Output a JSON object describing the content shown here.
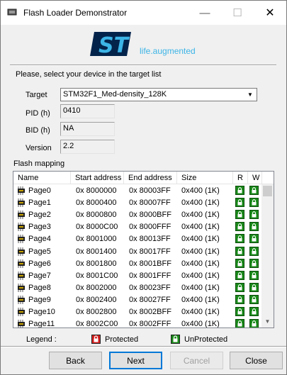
{
  "window": {
    "title": "Flash Loader Demonstrator",
    "min_icon": "minimize-icon",
    "max_icon": "maximize-icon",
    "close_icon": "close-icon"
  },
  "logo": {
    "brand": "ST",
    "tagline": "life.augmented",
    "brand_color": "#3cb4e6",
    "tagline_color": "#3cb4e6",
    "mark_color": "#03234b"
  },
  "prompt": "Please, select your device in the target list",
  "fields": {
    "target_label": "Target",
    "target_value": "STM32F1_Med-density_128K",
    "pid_label": "PID  (h)",
    "pid_value": "0410",
    "bid_label": "BID  (h)",
    "bid_value": "NA",
    "version_label": "Version",
    "version_value": "2.2"
  },
  "flash_mapping": {
    "label": "Flash mapping",
    "columns": [
      "Name",
      "Start address",
      "End address",
      "Size",
      "R",
      "W"
    ],
    "rows": [
      {
        "name": "Page0",
        "start": "0x 8000000",
        "end": "0x 80003FF",
        "size": "0x400 (1K)"
      },
      {
        "name": "Page1",
        "start": "0x 8000400",
        "end": "0x 80007FF",
        "size": "0x400 (1K)"
      },
      {
        "name": "Page2",
        "start": "0x 8000800",
        "end": "0x 8000BFF",
        "size": "0x400 (1K)"
      },
      {
        "name": "Page3",
        "start": "0x 8000C00",
        "end": "0x 8000FFF",
        "size": "0x400 (1K)"
      },
      {
        "name": "Page4",
        "start": "0x 8001000",
        "end": "0x 80013FF",
        "size": "0x400 (1K)"
      },
      {
        "name": "Page5",
        "start": "0x 8001400",
        "end": "0x 80017FF",
        "size": "0x400 (1K)"
      },
      {
        "name": "Page6",
        "start": "0x 8001800",
        "end": "0x 8001BFF",
        "size": "0x400 (1K)"
      },
      {
        "name": "Page7",
        "start": "0x 8001C00",
        "end": "0x 8001FFF",
        "size": "0x400 (1K)"
      },
      {
        "name": "Page8",
        "start": "0x 8002000",
        "end": "0x 80023FF",
        "size": "0x400 (1K)"
      },
      {
        "name": "Page9",
        "start": "0x 8002400",
        "end": "0x 80027FF",
        "size": "0x400 (1K)"
      },
      {
        "name": "Page10",
        "start": "0x 8002800",
        "end": "0x 8002BFF",
        "size": "0x400 (1K)"
      },
      {
        "name": "Page11",
        "start": "0x 8002C00",
        "end": "0x 8002FFF",
        "size": "0x400 (1K)"
      }
    ],
    "row_icon": "memory-chip-icon",
    "unprotected_color": "#1a8a1a"
  },
  "legend": {
    "label": "Legend :",
    "protected_label": "Protected",
    "unprotected_label": "UnProtected",
    "protected_color": "#d42020",
    "unprotected_color": "#1a8a1a"
  },
  "buttons": {
    "back": "Back",
    "next": "Next",
    "cancel": "Cancel",
    "close": "Close"
  }
}
